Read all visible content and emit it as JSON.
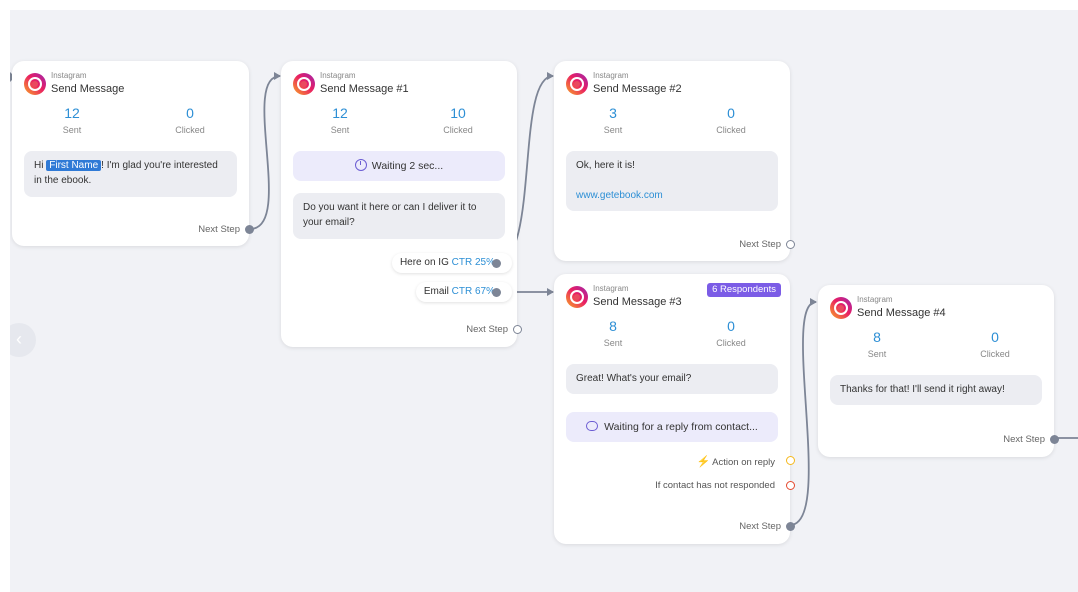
{
  "cards": [
    {
      "platform": "Instagram",
      "title": "Send Message",
      "sent": "12",
      "sent_label": "Sent",
      "clicked": "0",
      "clicked_label": "Clicked",
      "message_prefix": "Hi",
      "message_var": "First Name",
      "message_suffix": "! I'm glad you're interested in the ebook.",
      "next_step": "Next Step"
    },
    {
      "platform": "Instagram",
      "title": "Send Message #1",
      "sent": "12",
      "sent_label": "Sent",
      "clicked": "10",
      "clicked_label": "Clicked",
      "waiting": "Waiting 2 sec...",
      "message": "Do you want it here or can I deliver it to your email?",
      "buttons": [
        {
          "label": "Here on IG",
          "ctr": "CTR 25%"
        },
        {
          "label": "Email",
          "ctr": "CTR 67%"
        }
      ],
      "next_step": "Next Step"
    },
    {
      "platform": "Instagram",
      "title": "Send Message #2",
      "sent": "3",
      "sent_label": "Sent",
      "clicked": "0",
      "clicked_label": "Clicked",
      "message_line1": "Ok, here it is!",
      "message_link": "www.getebook.com",
      "next_step": "Next Step"
    },
    {
      "platform": "Instagram",
      "title": "Send Message #3",
      "badge": "6 Respondents",
      "sent": "8",
      "sent_label": "Sent",
      "clicked": "0",
      "clicked_label": "Clicked",
      "message": "Great! What's your email?",
      "waiting": "Waiting for a reply from contact...",
      "action_on_reply": "Action on reply",
      "not_responded": "If contact has not responded",
      "next_step": "Next Step"
    },
    {
      "platform": "Instagram",
      "title": "Send Message #4",
      "sent": "8",
      "sent_label": "Sent",
      "clicked": "0",
      "clicked_label": "Clicked",
      "message": "Thanks for that! I'll send it right away!",
      "next_step": "Next Step"
    }
  ],
  "colors": {
    "accent": "#2d8fd5",
    "badge": "#7b5ce6",
    "waiting_bg": "#ecebfb",
    "connector": "#7d8596"
  },
  "icons": [
    "instagram-icon",
    "clock-icon",
    "chat-icon",
    "lightning-icon",
    "chevron-left-icon"
  ]
}
